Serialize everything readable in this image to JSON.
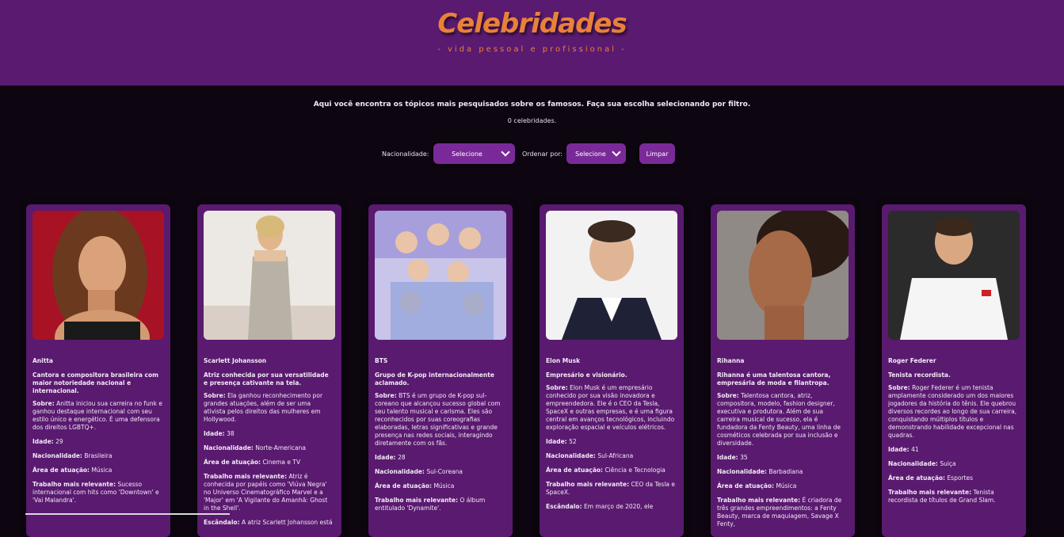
{
  "header": {
    "title": "Celebridades",
    "subtitle": "- vida pessoal e profissional -"
  },
  "intro": {
    "text": "Aqui você encontra os tópicos mais pesquisados sobre os famosos. Faça sua escolha selecionando por filtro.",
    "count": "0 celebridades."
  },
  "filters": {
    "nationality_label": "Nacionalidade:",
    "nationality_value": "Selecione",
    "order_label": "Ordenar por:",
    "order_value": "Selecione",
    "clear_label": "Limpar"
  },
  "labels": {
    "about": "Sobre:",
    "age": "Idade:",
    "nationality": "Nacionalidade:",
    "area": "Área de atuação:",
    "work": "Trabalho mais relevante:",
    "scandal": "Escândalo:"
  },
  "colors": {
    "header_bg": "#5a1a70",
    "accent_orange": "#e9813a",
    "page_bg": "#0d0610",
    "button_bg": "#7a2a98"
  },
  "cards": [
    {
      "name": "Anitta",
      "summary": "Cantora e compositora brasileira com maior notoriedade nacional e internacional.",
      "about": "Anitta iniciou sua carreira no funk e ganhou destaque internacional com seu estilo único e energético. É uma defensora dos direitos LGBTQ+.",
      "age": "29",
      "nationality": "Brasileira",
      "area": "Música",
      "work": "Sucesso internacional com hits como 'Downtown' e 'Vai Malandra'."
    },
    {
      "name": "Scarlett Johansson",
      "summary": "Atriz conhecida por sua versatilidade e presença cativante na tela.",
      "about": "Ela ganhou reconhecimento por grandes atuações, além de ser uma ativista pelos direitos das mulheres em Hollywood.",
      "age": "38",
      "nationality": "Norte-Americana",
      "area": "Cinema e TV",
      "work": "Atriz é conhecida por papéis como 'Viúva Negra' no Universo Cinematográfico Marvel e a 'Major' em 'A Vigilante do Amanhã: Ghost in the Shell'.",
      "scandal": "A atriz Scarlett Johansson está"
    },
    {
      "name": "BTS",
      "summary": "Grupo de K-pop internacionalmente aclamado.",
      "about": "BTS é um grupo de K-pop sul-coreano que alcançou sucesso global com seu talento musical e carisma. Eles são reconhecidos por suas coreografias elaboradas, letras significativas e grande presença nas redes sociais, interagindo diretamente com os fãs.",
      "age": "28",
      "nationality": "Sul-Coreana",
      "area": "Música",
      "work": "O álbum entitulado 'Dynamite'."
    },
    {
      "name": "Elon Musk",
      "summary": "Empresário e visionário.",
      "about": "Elon Musk é um empresário conhecido por sua visão inovadora e empreendedora. Ele é o CEO da Tesla, SpaceX e outras empresas, e é uma figura central em avanços tecnológicos, incluindo exploração espacial e veículos elétricos.",
      "age": "52",
      "nationality": "Sul-Africana",
      "area": "Ciência e Tecnologia",
      "work": "CEO da Tesla e SpaceX.",
      "scandal": "Em março de 2020, ele"
    },
    {
      "name": "Rihanna",
      "summary": "Rihanna é uma talentosa cantora, empresária de moda e filantropa.",
      "about": "Talentosa cantora, atriz, compositora, modelo, fashion designer, executiva e produtora. Além de sua carreira musical de sucesso, ela é fundadora da Fenty Beauty, uma linha de cosméticos celebrada por sua inclusão e diversidade.",
      "age": "35",
      "nationality": "Barbadiana",
      "area": "Música",
      "work": "É criadora de três grandes empreendimentos: a Fenty Beauty, marca de maquiagem, Savage X Fenty,"
    },
    {
      "name": "Roger Federer",
      "summary": "Tenista recordista.",
      "about": "Roger Federer é um tenista amplamente considerado um dos maiores jogadores da história do tênis. Ele quebrou diversos recordes ao longo de sua carreira, conquistando múltiplos títulos e demonstrando habilidade excepcional nas quadras.",
      "age": "41",
      "nationality": "Suiça",
      "area": "Esportes",
      "work": "Tenista recordista de títulos de Grand Slam."
    }
  ]
}
